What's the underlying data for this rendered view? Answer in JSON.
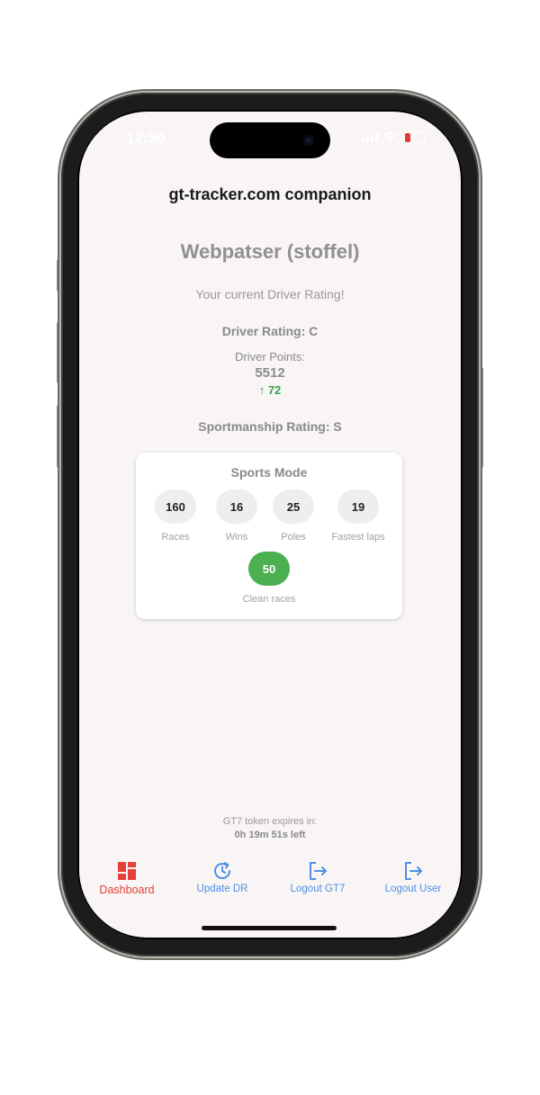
{
  "status_bar": {
    "time": "12:50"
  },
  "app": {
    "title": "gt-tracker.com companion"
  },
  "profile": {
    "name": "Webpatser (stoffel)",
    "subtitle": "Your current Driver Rating!",
    "driver_rating": "Driver Rating: C",
    "driver_points_label": "Driver Points:",
    "driver_points_value": "5512",
    "driver_points_change": "↑ 72",
    "sportsmanship_rating": "Sportmanship Rating: S"
  },
  "sports_mode": {
    "title": "Sports Mode",
    "stats": [
      {
        "value": "160",
        "label": "Races"
      },
      {
        "value": "16",
        "label": "Wins"
      },
      {
        "value": "25",
        "label": "Poles"
      },
      {
        "value": "19",
        "label": "Fastest laps"
      },
      {
        "value": "50",
        "label": "Clean races"
      }
    ]
  },
  "token": {
    "label": "GT7 token expires in:",
    "remaining": "0h 19m 51s left"
  },
  "nav": {
    "items": [
      {
        "label": "Dashboard",
        "icon": "dashboard-icon",
        "active": true
      },
      {
        "label": "Update DR",
        "icon": "refresh-clock-icon"
      },
      {
        "label": "Logout GT7",
        "icon": "logout-icon"
      },
      {
        "label": "Logout User",
        "icon": "logout-icon"
      }
    ]
  },
  "colors": {
    "accent_active": "#e5413c",
    "nav_inactive": "#4f8fe8",
    "positive": "#3aa24a",
    "clean_races_bubble": "#4caf50"
  }
}
